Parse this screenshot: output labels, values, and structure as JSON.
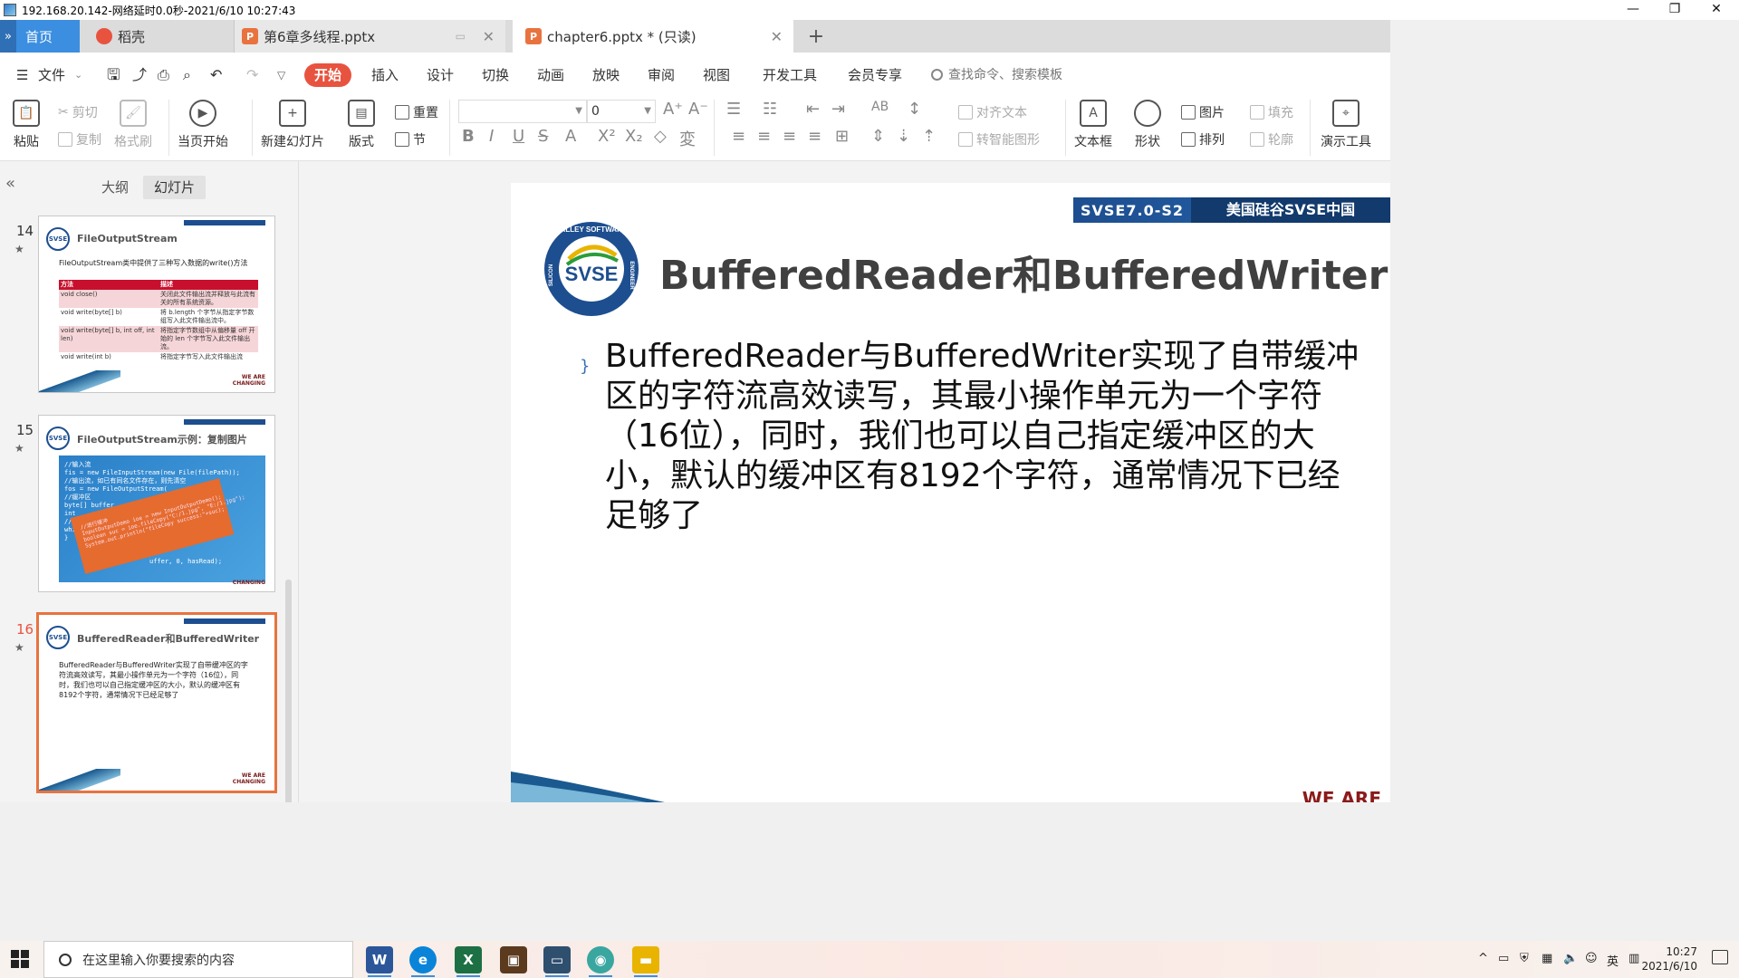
{
  "remote": {
    "title": "192.168.20.142-网络延时0.0秒-2021/6/10 10:27:43",
    "minimize": "—",
    "restore": "❐",
    "close": "✕"
  },
  "tabs": {
    "home": "首页",
    "daoke": "稻壳",
    "doc1": "第6章多线程.pptx",
    "doc2": "chapter6.pptx * (只读)",
    "add": "+",
    "close": "✕"
  },
  "menu": {
    "file": "文件",
    "items": [
      "开始",
      "插入",
      "设计",
      "切换",
      "动画",
      "放映",
      "审阅",
      "视图",
      "开发工具",
      "会员专享"
    ],
    "search_placeholder": "查找命令、搜索模板"
  },
  "ribbon": {
    "paste": "粘贴",
    "cut": "剪切",
    "copy": "复制",
    "format_painter": "格式刷",
    "start_from_current": "当页开始",
    "new_slide": "新建幻灯片",
    "layout": "版式",
    "reset": "重置",
    "section": "节",
    "font_size": "0",
    "align_text": "对齐文本",
    "smartart": "转智能图形",
    "textbox": "文本框",
    "shape": "形状",
    "picture": "图片",
    "arrange": "排列",
    "fill": "填充",
    "outline": "轮廓",
    "presentation_tools": "演示工具"
  },
  "panel": {
    "outline_tab": "大纲",
    "slides_tab": "幻灯片",
    "thumbs": [
      {
        "num": "14",
        "title": "FileOutputStream",
        "body": "FileOutputStream类中提供了三种写入数据的write()方法"
      },
      {
        "num": "15",
        "title": "FileOutputStream示例：复制图片"
      },
      {
        "num": "16",
        "title": "BufferedReader和BufferedWriter",
        "body": "BufferedReader与BufferedWriter实现了自带缓冲区的字符流高效读写，其最小操作单元为一个字符（16位），同时，我们也可以自己指定缓冲区的大小，默认的缓冲区有8192个字符，通常情况下已经足够了"
      }
    ],
    "table14": {
      "header": [
        "方法",
        "描述"
      ],
      "rows": [
        [
          "void close()",
          "关闭此文件输出流并释放与此流有关的所有系统资源。"
        ],
        [
          "void write(byte[] b)",
          "将 b.length 个字节从指定字节数组写入此文件输出流中。"
        ],
        [
          "void write(byte[] b, int off, int len)",
          "将指定字节数组中从偏移量 off 开始的 len 个字节写入此文件输出流。"
        ],
        [
          "void write(int b)",
          "将指定字节写入此文件输出流"
        ]
      ]
    },
    "code15": "//输入流\nfis = new FileInputStream(new File(filePath));\n//输出流，如已有同名文件存在，则先清空\nfos = new FileOutputStream(\n//缓冲区\nbyte[] buffer\nint\n//\nwhi\n}",
    "code15_tail": "uffer, 0, hasRead);",
    "stamp15": "//进行缓冲\nInputOutputDemo ioe = new InputOutputDemo();\nboolean suc = ioe.fileCopy(\"C:/1.jpg\", \"E:/1.jpg\");\nSystem.out.println(\"fileCopy success:\"+suc);",
    "we_are": "WE ARE",
    "changing": "CHANGING"
  },
  "slide": {
    "strip_left": "SVSE7.0-S2",
    "strip_right": "美国硅谷SVSE中国",
    "logo_text": "SVSE",
    "logo_ring_top": "VALLEY SOFTWARE",
    "logo_ring_side": "ENGINEER",
    "logo_ring_left": "SILICON",
    "title": "BufferedReader和BufferedWriter",
    "bullet": "}",
    "body": "BufferedReader与BufferedWriter实现了自带缓冲区的字符流高效读写，其最小操作单元为一个字符（16位），同时，我们也可以自己指定缓冲区的大小，默认的缓冲区有8192个字符，通常情况下已经足够了",
    "we_are": "WE ARE"
  },
  "taskbar": {
    "search_placeholder": "在这里输入你要搜索的内容",
    "time": "10:27",
    "date": "2021/6/10",
    "ime": "英",
    "chevron": "^"
  },
  "colors": {
    "accent": "#e8533f",
    "home_tab": "#3b8ee0",
    "slide_navy": "#1d4e8f"
  }
}
